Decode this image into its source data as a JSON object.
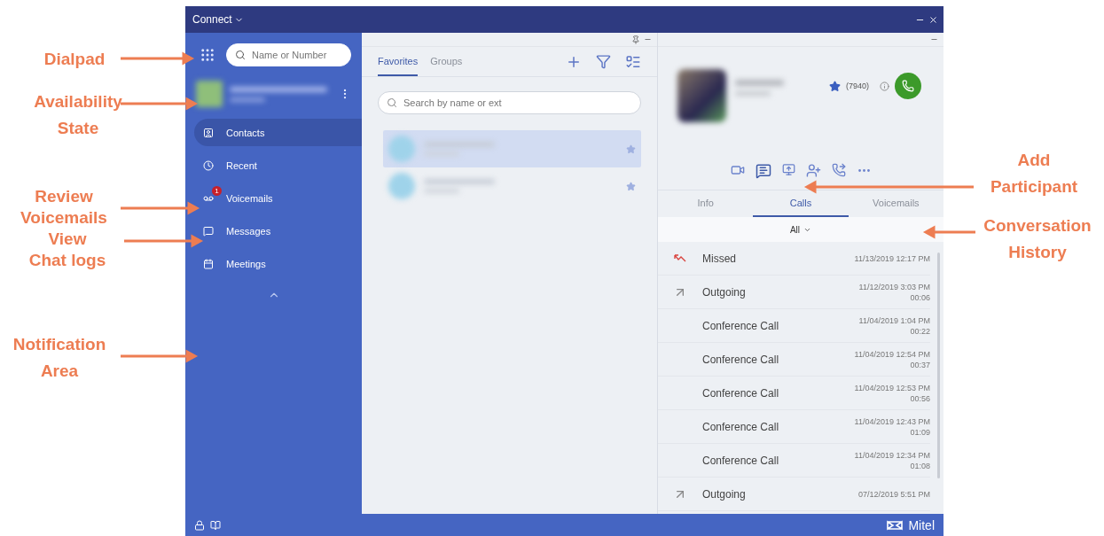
{
  "window": {
    "title": "Connect"
  },
  "sidebar": {
    "search": {
      "placeholder": "Name or Number"
    },
    "nav": [
      {
        "label": "Contacts",
        "kind": "contacts",
        "selected": true
      },
      {
        "label": "Recent",
        "kind": "recent",
        "selected": false
      },
      {
        "label": "Voicemails",
        "kind": "voicemail",
        "selected": false,
        "badge": "1"
      },
      {
        "label": "Messages",
        "kind": "messages",
        "selected": false
      },
      {
        "label": "Meetings",
        "kind": "meetings",
        "selected": false
      }
    ]
  },
  "contacts_panel": {
    "tabs": [
      {
        "label": "Favorites",
        "selected": true
      },
      {
        "label": "Groups",
        "selected": false
      }
    ],
    "search": {
      "placeholder": "Search by name or ext"
    },
    "contacts": [
      {
        "selected": true,
        "favorite": true
      },
      {
        "selected": false,
        "favorite": true
      }
    ]
  },
  "detail_panel": {
    "extension": "(7940)",
    "favorite": true,
    "tabs": [
      {
        "label": "Info",
        "selected": false
      },
      {
        "label": "Calls",
        "selected": true
      },
      {
        "label": "Voicemails",
        "selected": false
      }
    ],
    "filter": "All",
    "calls": [
      {
        "kind": "missed",
        "label": "Missed",
        "date": "11/13/2019 12:17 PM"
      },
      {
        "kind": "outgoing",
        "label": "Outgoing",
        "date": "11/12/2019 3:03 PM",
        "duration": "00:06"
      },
      {
        "kind": "conference",
        "label": "Conference Call",
        "date": "11/04/2019 1:04 PM",
        "duration": "00:22"
      },
      {
        "kind": "conference",
        "label": "Conference Call",
        "date": "11/04/2019 12:54 PM",
        "duration": "00:37"
      },
      {
        "kind": "conference",
        "label": "Conference Call",
        "date": "11/04/2019 12:53 PM",
        "duration": "00:56"
      },
      {
        "kind": "conference",
        "label": "Conference Call",
        "date": "11/04/2019 12:43 PM",
        "duration": "01:09"
      },
      {
        "kind": "conference",
        "label": "Conference Call",
        "date": "11/04/2019 12:34 PM",
        "duration": "01:08"
      },
      {
        "kind": "outgoing",
        "label": "Outgoing",
        "date": "07/12/2019 5:51 PM"
      }
    ]
  },
  "status_bar": {
    "brand": "Mitel"
  },
  "annotations": [
    {
      "lines": [
        "Dialpad"
      ]
    },
    {
      "lines": [
        "Availability",
        "State"
      ]
    },
    {
      "lines": [
        "Review",
        "Voicemails"
      ]
    },
    {
      "lines": [
        "View",
        "Chat logs"
      ]
    },
    {
      "lines": [
        "Notification",
        "Area"
      ]
    },
    {
      "lines": [
        "Add",
        "Participant"
      ]
    },
    {
      "lines": [
        "Conversation",
        "History"
      ]
    }
  ]
}
